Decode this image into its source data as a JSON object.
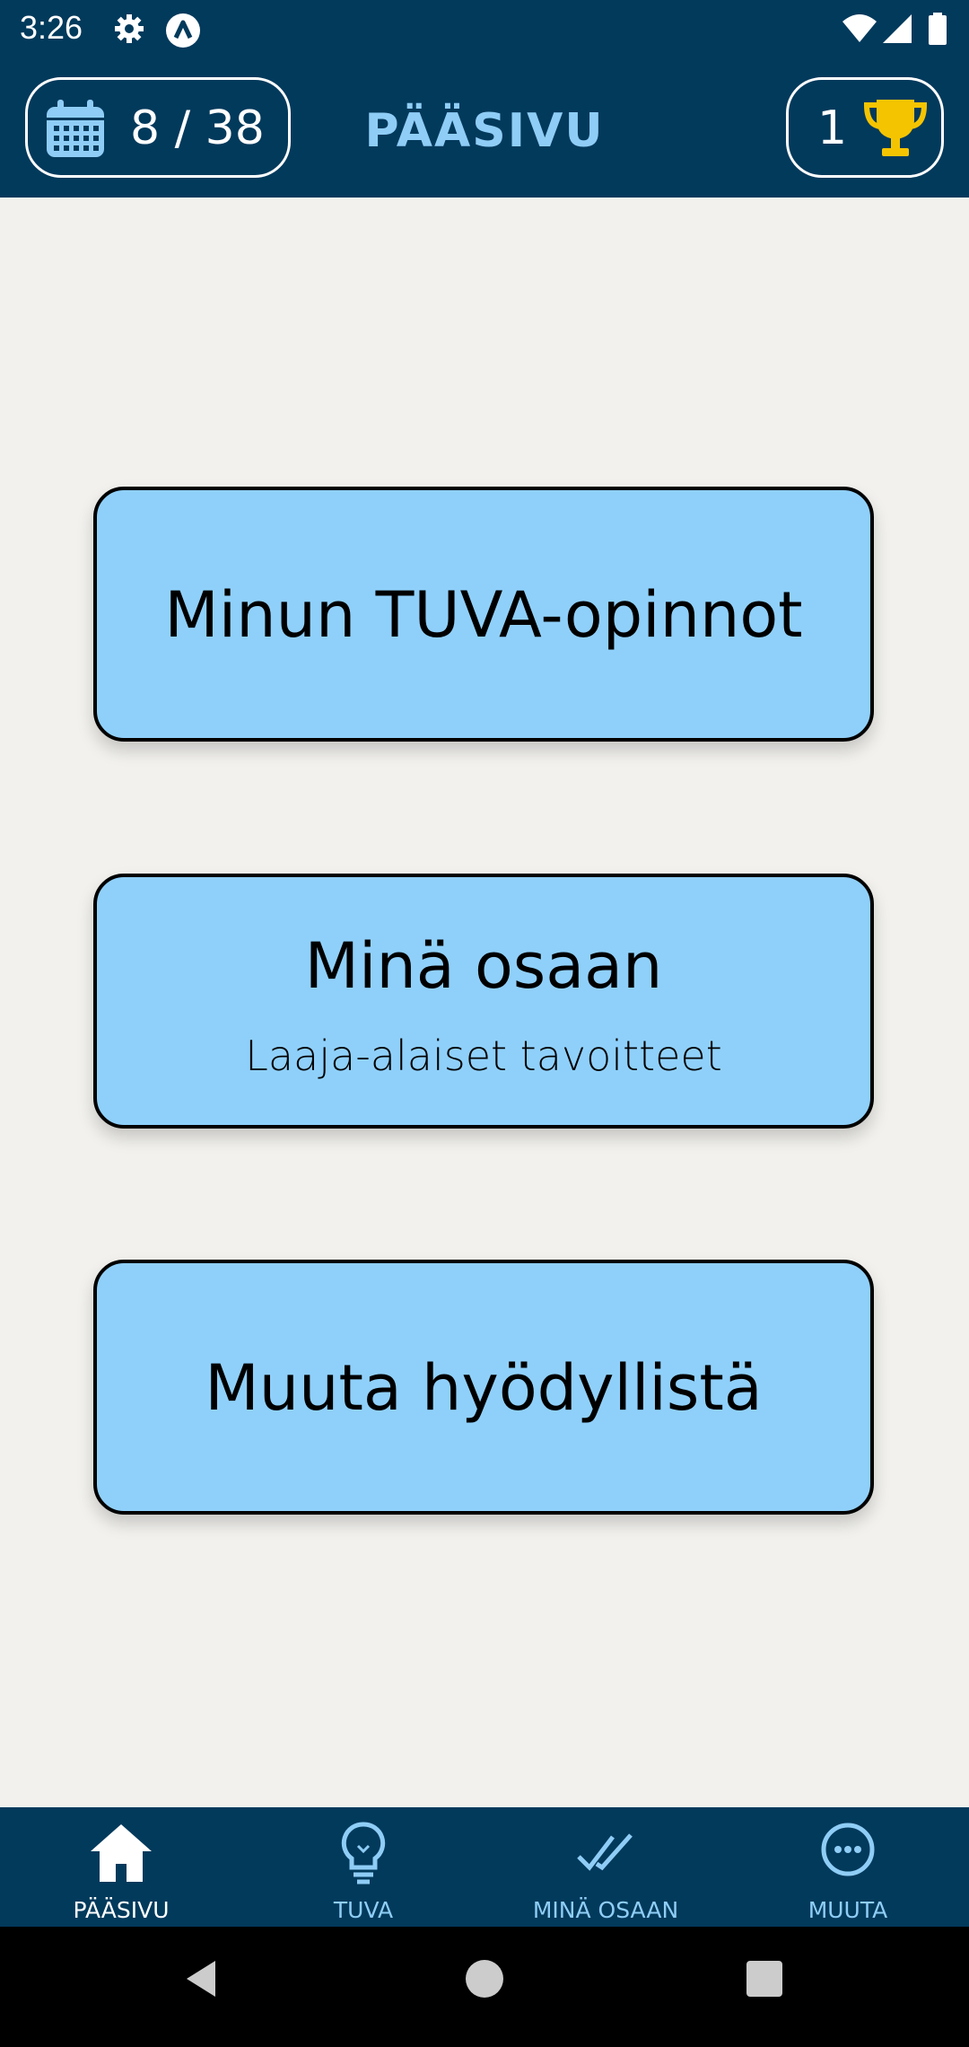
{
  "status_bar": {
    "time": "3:26",
    "icons": [
      "gear-icon",
      "app-notification-icon",
      "wifi-icon",
      "cellular-signal-icon",
      "battery-icon"
    ]
  },
  "header": {
    "day_counter": "8 / 38",
    "title": "PÄÄSIVU",
    "trophy_count": "1"
  },
  "menu": [
    {
      "label": "Minun TUVA-opinnot",
      "sublabel": ""
    },
    {
      "label": "Minä osaan",
      "sublabel": "Laaja-alaiset tavoitteet"
    },
    {
      "label": "Muuta hyödyllistä",
      "sublabel": ""
    }
  ],
  "bottom_nav": [
    {
      "label": "PÄÄSIVU",
      "icon": "home-icon",
      "active": true
    },
    {
      "label": "TUVA",
      "icon": "lightbulb-icon",
      "active": false
    },
    {
      "label": "MINÄ OSAAN",
      "icon": "double-check-icon",
      "active": false
    },
    {
      "label": "MUUTA",
      "icon": "more-circle-icon",
      "active": false
    }
  ],
  "colors": {
    "header_bg": "#023a5c",
    "title_text": "#8fcdf6",
    "card_bg": "#8fd0fa",
    "page_bg": "#f2f1ed",
    "trophy": "#f5c400",
    "nav_active": "#ffffff",
    "nav_inactive": "#8fcdf6"
  }
}
